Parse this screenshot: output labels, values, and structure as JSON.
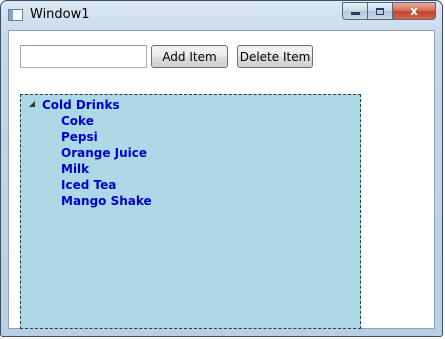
{
  "window": {
    "title": "Window1"
  },
  "caption": {
    "close_glyph": "x"
  },
  "toolbar": {
    "input_value": "",
    "add_label": "Add Item",
    "delete_label": "Delete Item"
  },
  "tree": {
    "root": {
      "label": "Cold Drinks",
      "expanded": true
    },
    "items": [
      "Coke",
      "Pepsi",
      "Orange Juice",
      "Milk",
      "Iced Tea",
      "Mango Shake"
    ]
  },
  "colors": {
    "tree_background": "#add8e6",
    "item_text": "#0000cd"
  }
}
